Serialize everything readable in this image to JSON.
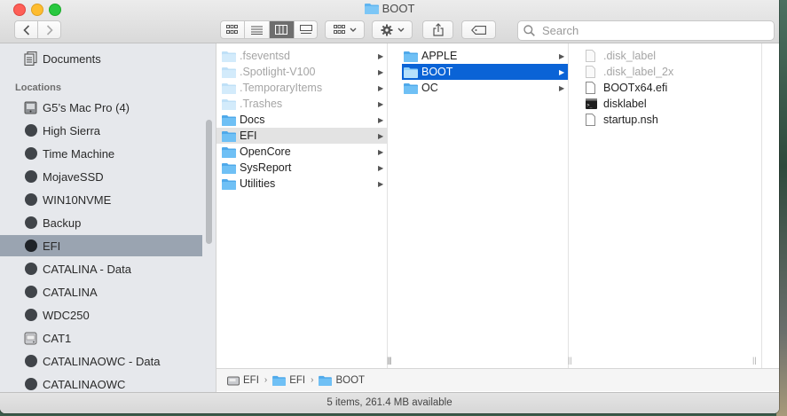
{
  "window": {
    "title": "BOOT"
  },
  "toolbar": {
    "search_placeholder": "Search"
  },
  "sidebar": {
    "top_items": [
      {
        "label": "Documents",
        "icon": "documents-icon"
      }
    ],
    "section_title": "Locations",
    "locations": [
      {
        "label": "G5’s Mac Pro (4)",
        "icon": "computer-icon"
      },
      {
        "label": "High Sierra",
        "icon": "disk-icon"
      },
      {
        "label": "Time Machine",
        "icon": "disk-icon"
      },
      {
        "label": "MojaveSSD",
        "icon": "disk-icon"
      },
      {
        "label": "WIN10NVME",
        "icon": "disk-icon"
      },
      {
        "label": "Backup",
        "icon": "disk-icon"
      },
      {
        "label": "EFI",
        "icon": "disk-icon",
        "selected": true
      },
      {
        "label": "CATALINA - Data",
        "icon": "disk-icon"
      },
      {
        "label": "CATALINA",
        "icon": "disk-icon"
      },
      {
        "label": "WDC250",
        "icon": "disk-icon"
      },
      {
        "label": "CAT1",
        "icon": "hard-drive-icon"
      },
      {
        "label": "CATALINAOWC - Data",
        "icon": "disk-icon"
      },
      {
        "label": "CATALINAOWC",
        "icon": "disk-icon"
      }
    ]
  },
  "columns": {
    "col1": [
      {
        "label": ".fseventsd",
        "dim": true
      },
      {
        "label": ".Spotlight-V100",
        "dim": true
      },
      {
        "label": ".TemporaryItems",
        "dim": true
      },
      {
        "label": ".Trashes",
        "dim": true
      },
      {
        "label": "Docs"
      },
      {
        "label": "EFI",
        "highlighted": true
      },
      {
        "label": "OpenCore"
      },
      {
        "label": "SysReport"
      },
      {
        "label": "Utilities"
      }
    ],
    "col2": [
      {
        "label": "APPLE"
      },
      {
        "label": "BOOT",
        "selected": true
      },
      {
        "label": "OC"
      }
    ],
    "col3": [
      {
        "label": ".disk_label",
        "dim": true,
        "icon": "file-icon"
      },
      {
        "label": ".disk_label_2x",
        "dim": true,
        "icon": "file-icon"
      },
      {
        "label": "BOOTx64.efi",
        "icon": "file-icon"
      },
      {
        "label": "disklabel",
        "icon": "terminal-icon"
      },
      {
        "label": "startup.nsh",
        "icon": "file-icon"
      }
    ]
  },
  "pathbar": {
    "crumbs": [
      "EFI",
      "EFI",
      "BOOT"
    ]
  },
  "status": {
    "text": "5 items, 261.4 MB available"
  },
  "colors": {
    "selection": "#0a63d6",
    "folder": "#5fb4f0",
    "sidebar_selected": "#9aa4b1"
  }
}
